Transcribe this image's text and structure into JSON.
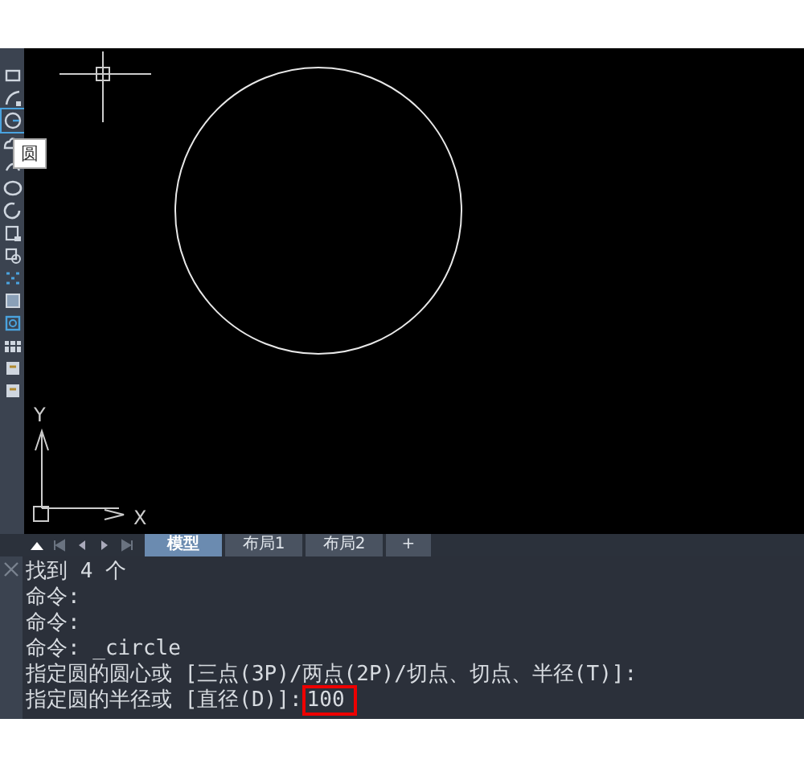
{
  "toolbar": {
    "items": [
      {
        "selected": false
      },
      {
        "selected": false
      },
      {
        "selected": true
      },
      {
        "selected": false
      },
      {
        "selected": false
      },
      {
        "selected": false
      },
      {
        "selected": false
      },
      {
        "selected": false
      },
      {
        "selected": false
      },
      {
        "selected": false
      },
      {
        "selected": false
      },
      {
        "selected": false
      },
      {
        "selected": false
      },
      {
        "selected": false
      },
      {
        "selected": false
      }
    ],
    "tooltip": "圆"
  },
  "canvas": {
    "x_axis": "X",
    "y_axis": "Y"
  },
  "tabs": [
    {
      "label": "模型",
      "selected": true
    },
    {
      "label": "布局1",
      "selected": false
    },
    {
      "label": "布局2",
      "selected": false
    },
    {
      "label": "+",
      "selected": false
    }
  ],
  "command": {
    "lines": [
      "找到 4 个",
      "命令:",
      "命令:",
      "命令: _circle",
      "指定圆的圆心或 [三点(3P)/两点(2P)/切点、切点、半径(T)]:"
    ],
    "prompt": "指定圆的半径或 [直径(D)]:",
    "value": "100"
  }
}
